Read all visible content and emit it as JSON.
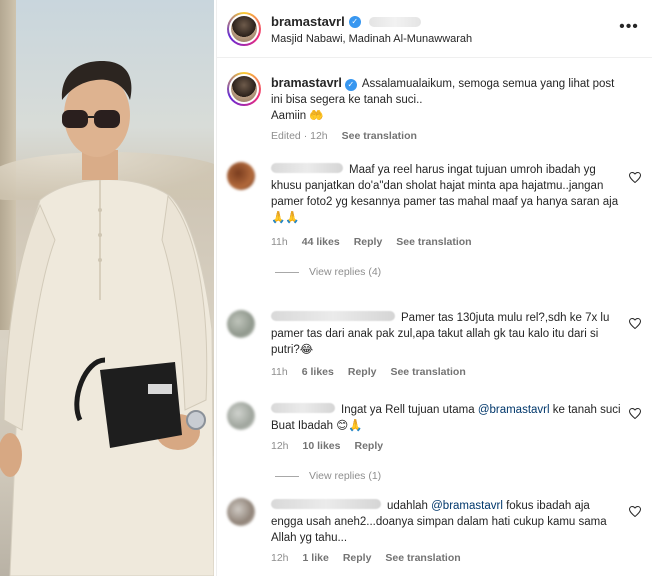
{
  "post": {
    "username": "bramastavrl",
    "location": "Masjid Nabawi, Madinah Al-Munawwarah",
    "more_icon": "more-horizontal-icon"
  },
  "caption": {
    "username": "bramastavrl",
    "text_line1": "Assalamualaikum, semoga semua yang lihat post",
    "text_line2": "ini bisa segera ke tanah suci..",
    "text_line3": "Aamiin 🤲",
    "edited": "Edited · 12h",
    "see_translation": "See translation"
  },
  "comments": [
    {
      "text": "Maaf ya reel harus ingat tujuan umroh ibadah yg khusu panjatkan do'a\"dan sholat hajat minta apa hajatmu..jangan pamer foto2 yg kesannya pamer tas mahal maaf ya hanya saran aja🙏🙏",
      "time": "11h",
      "likes": "44 likes",
      "reply": "Reply",
      "see_translation": "See translation",
      "view_replies": "View replies (4)"
    },
    {
      "text": "Pamer tas 130juta mulu rel?,sdh ke 7x lu pamer tas dari anak pak zul,apa takut allah gk tau kalo itu dari si putri?😂",
      "time": "11h",
      "likes": "6 likes",
      "reply": "Reply",
      "see_translation": "See translation"
    },
    {
      "text_before": "Ingat ya Rell tujuan utama ",
      "mention": "@bramastavrl",
      "text_after": " ke tanah suci Buat Ibadah 😊🙏",
      "time": "12h",
      "likes": "10 likes",
      "reply": "Reply",
      "view_replies": "View replies (1)"
    },
    {
      "text_before": "udahlah ",
      "mention": "@bramastavrl",
      "text_after": " fokus ibadah aja engga usah aneh2...doanya simpan dalam hati cukup kamu sama Allah yg tahu...",
      "time": "12h",
      "likes": "1 like",
      "reply": "Reply",
      "see_translation": "See translation"
    }
  ],
  "icons": {
    "verified": "verified-badge-icon",
    "heart": "heart-outline-icon"
  },
  "colors": {
    "verified_blue": "#3897f0",
    "mention_blue": "#00376b",
    "meta_gray": "#8e8e8e",
    "text_dark": "#262626"
  }
}
